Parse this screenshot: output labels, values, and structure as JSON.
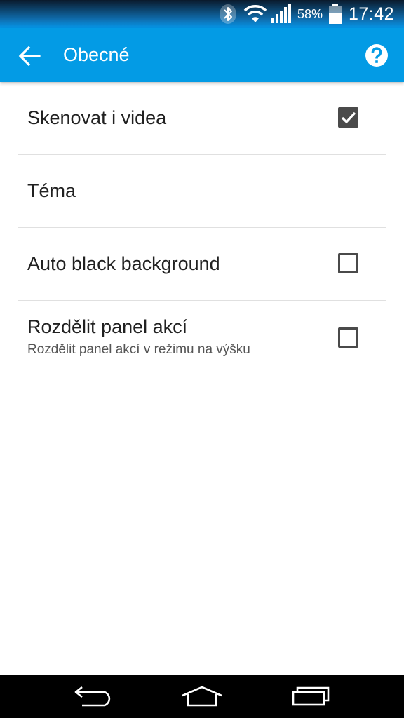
{
  "status_bar": {
    "battery_percent": "58%",
    "time": "17:42",
    "icons": [
      "bluetooth-icon",
      "wifi-icon",
      "cell-signal-icon",
      "battery-icon"
    ]
  },
  "app_bar": {
    "title": "Obecné",
    "back_icon": "arrow-back-icon",
    "help_icon": "help-circle-icon",
    "background_color": "#039be5"
  },
  "settings": [
    {
      "title": "Skenovat i videa",
      "summary": "",
      "checkbox": true,
      "checked": true
    },
    {
      "title": "Téma",
      "summary": "",
      "checkbox": false,
      "checked": false
    },
    {
      "title": "Auto black background",
      "summary": "",
      "checkbox": true,
      "checked": false
    },
    {
      "title": "Rozdělit panel akcí",
      "summary": "Rozdělit panel akcí v režimu na výšku",
      "checkbox": true,
      "checked": false
    }
  ],
  "nav_bar": {
    "icons": [
      "nav-back-icon",
      "nav-home-icon",
      "nav-recents-icon"
    ]
  }
}
